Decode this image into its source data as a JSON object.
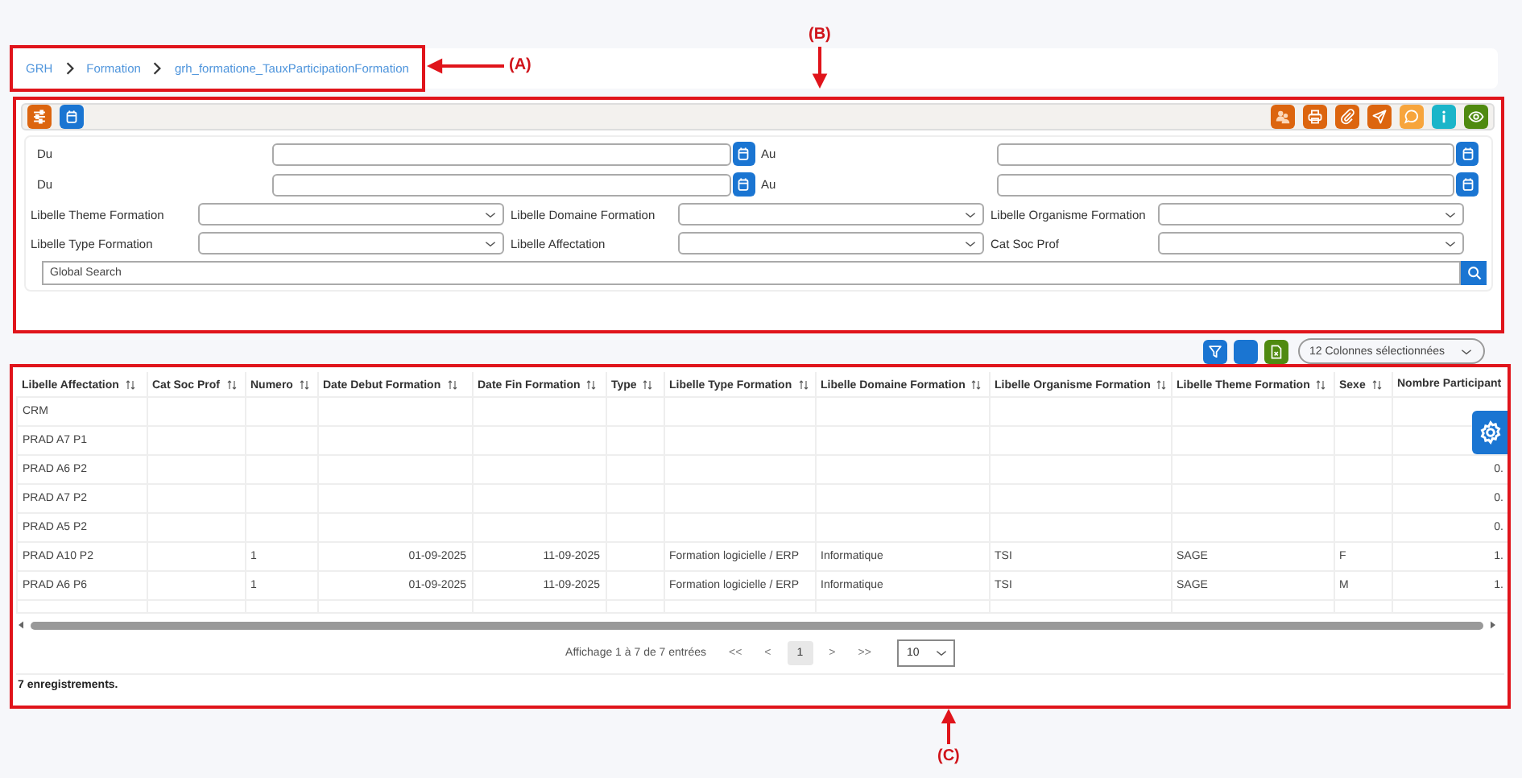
{
  "annotations": [
    {
      "label": "(A)"
    },
    {
      "label": "(B)"
    },
    {
      "label": "(C)"
    }
  ],
  "breadcrumb": [
    {
      "label": "GRH"
    },
    {
      "label": "Formation"
    },
    {
      "label": "grh_formatione_TauxParticipationFormation"
    }
  ],
  "filters": {
    "date_rows": [
      {
        "label": "Du",
        "label_end": "Au"
      },
      {
        "label": "Du",
        "label_end": "Au"
      }
    ],
    "select_rows": [
      [
        {
          "label": "Libelle Theme Formation"
        },
        {
          "label": "Libelle Domaine Formation"
        },
        {
          "label": "Libelle Organisme Formation"
        }
      ],
      [
        {
          "label": "Libelle Type Formation"
        },
        {
          "label": "Libelle Affectation"
        },
        {
          "label": "Cat Soc Prof"
        }
      ]
    ],
    "search": {
      "placeholder": "Global Search"
    }
  },
  "columns_dropdown": {
    "value": "12 Colonnes sélectionnées"
  },
  "table": {
    "columns": [
      {
        "label": "Libelle Affectation",
        "sortable": true
      },
      {
        "label": "Cat Soc Prof",
        "sortable": true
      },
      {
        "label": "Numero",
        "sortable": true
      },
      {
        "label": "Date Debut Formation",
        "sortable": true
      },
      {
        "label": "Date Fin Formation",
        "sortable": true
      },
      {
        "label": "Type",
        "sortable": true
      },
      {
        "label": "Libelle Type Formation",
        "sortable": true
      },
      {
        "label": "Libelle Domaine Formation",
        "sortable": true
      },
      {
        "label": "Libelle Organisme Formation",
        "sortable": true
      },
      {
        "label": "Libelle Theme Formation",
        "sortable": true
      },
      {
        "label": "Sexe",
        "sortable": true
      },
      {
        "label": "Nombre Participant",
        "sortable": false
      }
    ],
    "rows": [
      [
        "CRM",
        null,
        null,
        null,
        null,
        null,
        null,
        null,
        null,
        null,
        null,
        null
      ],
      [
        "PRAD A7 P1",
        null,
        null,
        null,
        null,
        null,
        null,
        null,
        null,
        null,
        null,
        null
      ],
      [
        "PRAD A6 P2",
        null,
        null,
        null,
        null,
        null,
        null,
        null,
        null,
        null,
        null,
        "0."
      ],
      [
        "PRAD A7 P2",
        null,
        null,
        null,
        null,
        null,
        null,
        null,
        null,
        null,
        null,
        "0."
      ],
      [
        "PRAD A5 P2",
        null,
        null,
        null,
        null,
        null,
        null,
        null,
        null,
        null,
        null,
        "0."
      ],
      [
        "PRAD A10 P2",
        null,
        "1",
        "01-09-2025",
        "11-09-2025",
        null,
        "Formation logicielle / ERP",
        "Informatique",
        "TSI",
        "SAGE",
        "F",
        "1."
      ],
      [
        "PRAD A6 P6",
        null,
        "1",
        "01-09-2025",
        "11-09-2025",
        null,
        "Formation logicielle / ERP",
        "Informatique",
        "TSI",
        "SAGE",
        "M",
        "1."
      ]
    ]
  },
  "pagination": {
    "info": "Affichage 1 à 7 de 7 entrées",
    "first": "<<",
    "previous": "<",
    "pages": [
      {
        "label": "1",
        "selected": true
      }
    ],
    "next": ">",
    "last": ">>",
    "page_size": "10"
  },
  "footer": "7 enregistrements."
}
